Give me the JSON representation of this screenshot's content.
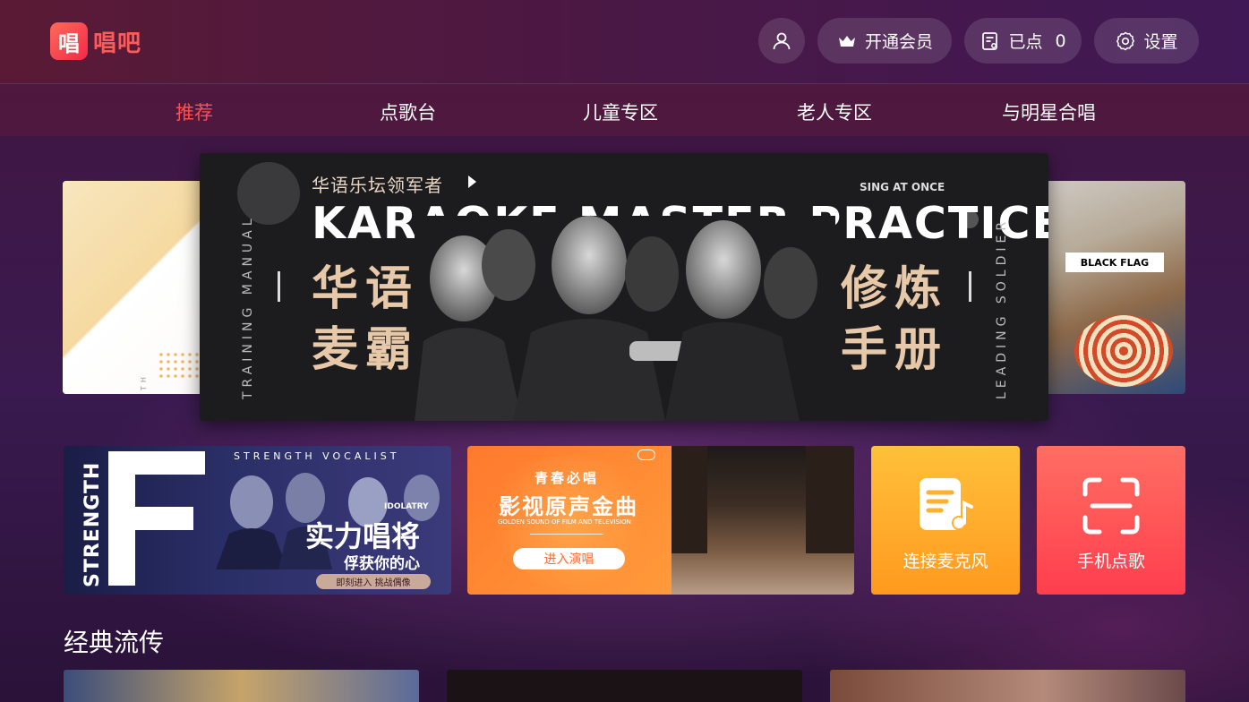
{
  "app": {
    "logo_glyph": "唱",
    "logo_text": "唱吧"
  },
  "header": {
    "profile_icon": "user-icon",
    "vip_label": "开通会员",
    "queue_label": "已点",
    "queue_count": "0",
    "settings_label": "设置"
  },
  "nav": {
    "items": [
      {
        "label": "推荐",
        "active": true
      },
      {
        "label": "点歌台",
        "active": false
      },
      {
        "label": "儿童专区",
        "active": false
      },
      {
        "label": "老人专区",
        "active": false
      },
      {
        "label": "与明星合唱",
        "active": false
      }
    ],
    "active_color": "#ff4f4f"
  },
  "banner": {
    "side_left_text": "BLUETOOTH",
    "side_right_text": "BLACK FLAG",
    "subtitle": "华语乐坛领军者",
    "tag": "SING AT ONCE",
    "title": "KARAOKE MASTER PRACTICE",
    "left_vertical": "TRAINING MANUAL",
    "right_vertical": "LEADING SOLDIER",
    "left_big_1": "华语",
    "left_big_2": "麦霸",
    "right_big_1": "修炼",
    "right_big_2": "手册"
  },
  "tiles": {
    "strength": {
      "vertical": "STRENGTH",
      "top": "STRENGTH VOCALIST",
      "idol": "IDOLATRY",
      "title": "实力唱将",
      "subtitle": "俘获你的心",
      "pill": "即刻进入 挑战偶像"
    },
    "soundtrack": {
      "small": "青春必唱",
      "title": "影视原声金曲",
      "english": "GOLDEN SOUND OF FILM AND TELEVISION",
      "button": "进入演唱"
    },
    "mic": {
      "label": "连接麦克风",
      "icon": "music-note-icon",
      "color": "#ffb02e"
    },
    "phone": {
      "label": "手机点歌",
      "icon": "scan-icon",
      "color": "#ff4f58"
    }
  },
  "section": {
    "title": "经典流传"
  }
}
